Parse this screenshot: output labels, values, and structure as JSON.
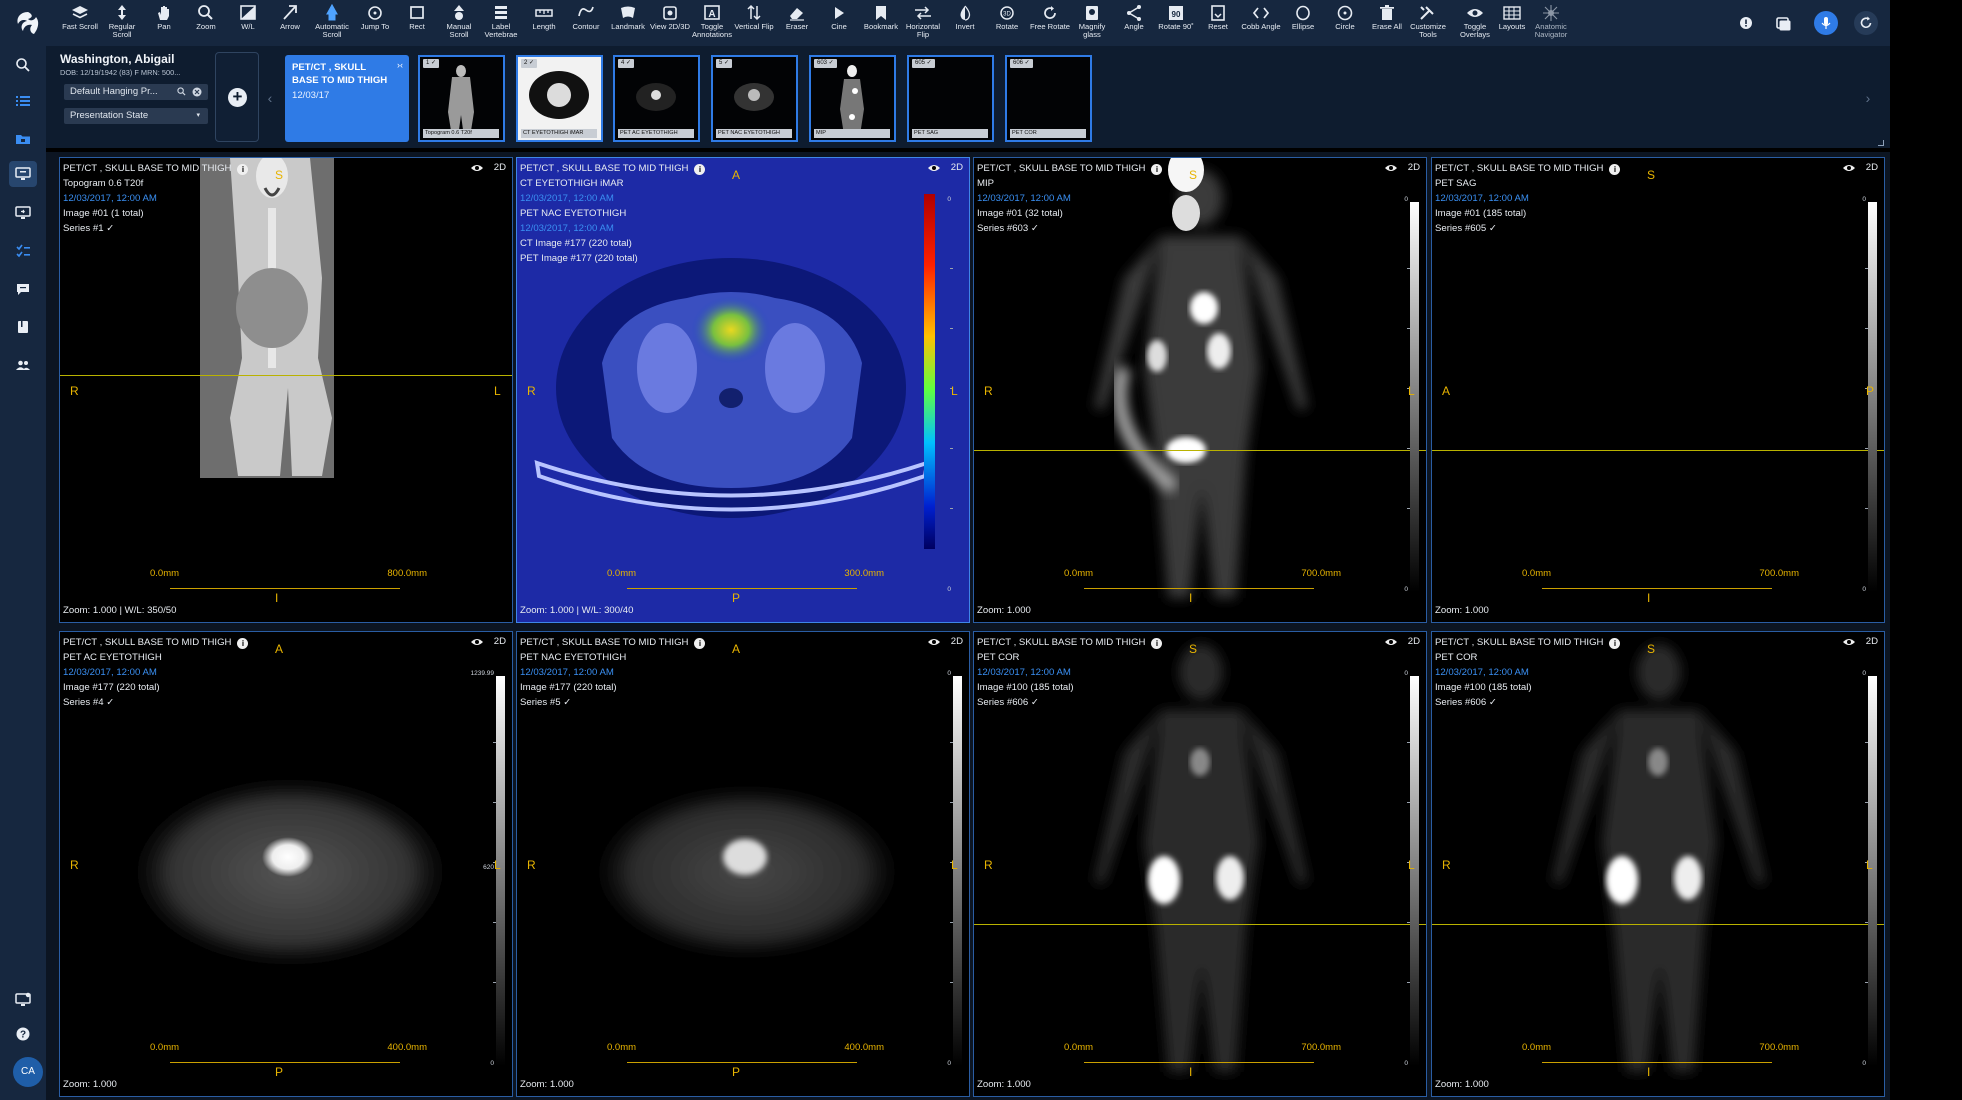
{
  "toolbar": {
    "tools": [
      {
        "label": "Fast Scroll",
        "icon": "layers-icon"
      },
      {
        "label": "Regular Scroll",
        "icon": "scroll-icon"
      },
      {
        "label": "Pan",
        "icon": "hand-icon"
      },
      {
        "label": "Zoom",
        "icon": "magnifier-icon"
      },
      {
        "label": "W/L",
        "icon": "contrast-icon"
      },
      {
        "label": "Arrow",
        "icon": "arrow-icon"
      },
      {
        "label": "Automatic Scroll",
        "icon": "auto-scroll-icon"
      },
      {
        "label": "Jump To",
        "icon": "target-icon"
      },
      {
        "label": "Rect",
        "icon": "rect-icon"
      },
      {
        "label": "Manual Scroll",
        "icon": "manual-scroll-icon"
      },
      {
        "label": "Label Vertebrae",
        "icon": "label-icon"
      },
      {
        "label": "Length",
        "icon": "ruler-icon"
      },
      {
        "label": "Contour",
        "icon": "contour-icon"
      },
      {
        "label": "Landmark",
        "icon": "landmark-icon"
      },
      {
        "label": "View 2D/3D",
        "icon": "view-icon"
      },
      {
        "label": "Toggle Annotations",
        "icon": "annotation-icon"
      },
      {
        "label": "Vertical Flip",
        "icon": "vflip-icon"
      },
      {
        "label": "Eraser",
        "icon": "eraser-icon"
      },
      {
        "label": "Cine",
        "icon": "play-icon"
      },
      {
        "label": "Bookmark",
        "icon": "bookmark-icon"
      },
      {
        "label": "Horizontal Flip",
        "icon": "hflip-icon"
      },
      {
        "label": "Invert",
        "icon": "invert-icon"
      },
      {
        "label": "Rotate",
        "icon": "rotate-icon"
      },
      {
        "label": "Free Rotate",
        "icon": "free-rotate-icon"
      },
      {
        "label": "Magnify glass",
        "icon": "magnify-glass-icon"
      },
      {
        "label": "Angle",
        "icon": "angle-icon"
      },
      {
        "label": "Rotate 90˚",
        "icon": "rotate90-icon"
      },
      {
        "label": "Reset",
        "icon": "reset-icon"
      },
      {
        "label": "Cobb Angle",
        "icon": "cobb-icon"
      },
      {
        "label": "Ellipse",
        "icon": "ellipse-icon"
      },
      {
        "label": "Circle",
        "icon": "circle-icon"
      },
      {
        "label": "Erase All",
        "icon": "trash-icon"
      },
      {
        "label": "Customize Tools",
        "icon": "tools-icon"
      },
      {
        "label": "Toggle Overlays",
        "icon": "eye-icon"
      },
      {
        "label": "Layouts",
        "icon": "grid-icon"
      },
      {
        "label": "Anatomic Navigator",
        "icon": "navigator-icon"
      }
    ],
    "right_icons": [
      "alert-icon",
      "window-icon",
      "microphone-icon",
      "refresh-icon"
    ]
  },
  "sidebar": {
    "items": [
      "search-icon",
      "list-icon",
      "folder-icon",
      "monitor-icon",
      "monitor-out-icon",
      "checklist-icon",
      "chat-icon",
      "book-icon",
      "users-icon"
    ],
    "bottom": [
      "screen-icon",
      "help-icon"
    ],
    "avatar": "CA"
  },
  "patient": {
    "name": "Washington, Abigail",
    "dob_line": "DOB: 12/19/1942 (83)    F    MRN: 500...",
    "hanging": "Default Hanging Pr...",
    "presentation": "Presentation State"
  },
  "study": {
    "title": "PET/CT , SKULL BASE TO MID THIGH",
    "date": "12/03/17"
  },
  "thumbnails": [
    {
      "badge": "1 ✓",
      "caption": "Topogram 0.6 T20f"
    },
    {
      "badge": "2 ✓",
      "caption": "CT EYETOTHIGH iMAR"
    },
    {
      "badge": "4 ✓",
      "caption": "PET AC EYETOTHIGH"
    },
    {
      "badge": "5 ✓",
      "caption": "PET NAC EYETOTHIGH"
    },
    {
      "badge": "603 ✓",
      "caption": "MIP"
    },
    {
      "badge": "605 ✓",
      "caption": "PET SAG"
    },
    {
      "badge": "606 ✓",
      "caption": "PET COR"
    }
  ],
  "viewports": [
    {
      "study": "PET/CT , SKULL BASE TO MID THIGH",
      "series_desc": "Topogram 0.6 T20f",
      "datetime": "12/03/2017, 12:00 AM",
      "line3": "Image #01 (1 total)",
      "line4": "Series #1 ✓",
      "mode": "2D",
      "top": "S",
      "bottom": "I",
      "left": "R",
      "right": "L",
      "scale_start": "0.0mm",
      "scale_end": "800.0mm",
      "zoom": "Zoom: 1.000 | W/L: 350/50"
    },
    {
      "study": "PET/CT , SKULL BASE TO MID THIGH",
      "series_desc": "CT EYETOTHIGH iMAR",
      "series_desc2": "PET NAC EYETOTHIGH",
      "datetime": "12/03/2017, 12:00 AM",
      "datetime2": "12/03/2017, 12:00 AM",
      "line3": "CT Image #177 (220 total)",
      "line4": "PET Image #177 (220 total)",
      "mode": "2D",
      "top": "A",
      "bottom": "P",
      "left": "R",
      "right": "L",
      "scale_start": "0.0mm",
      "scale_end": "300.0mm",
      "zoom": "Zoom: 1.000 | W/L: 300/40",
      "colorbar_top": "0",
      "colorbar_bottom": "0"
    },
    {
      "study": "PET/CT , SKULL BASE TO MID THIGH",
      "series_desc": "MIP",
      "datetime": "12/03/2017, 12:00 AM",
      "line3": "Image #01 (32 total)",
      "line4": "Series #603 ✓",
      "mode": "2D",
      "top": "S",
      "bottom": "I",
      "left": "R",
      "right": "L",
      "scale_start": "0.0mm",
      "scale_end": "700.0mm",
      "zoom": "Zoom: 1.000",
      "colorbar_top": "0",
      "colorbar_bottom": "0"
    },
    {
      "study": "PET/CT , SKULL BASE TO MID THIGH",
      "series_desc": "PET SAG",
      "datetime": "12/03/2017, 12:00 AM",
      "line3": "Image #01 (185 total)",
      "line4": "Series #605 ✓",
      "mode": "2D",
      "top": "S",
      "bottom": "I",
      "left": "A",
      "right": "P",
      "scale_start": "0.0mm",
      "scale_end": "700.0mm",
      "zoom": "Zoom: 1.000",
      "colorbar_top": "0",
      "colorbar_bottom": "0"
    },
    {
      "study": "PET/CT , SKULL BASE TO MID THIGH",
      "series_desc": "PET AC EYETOTHIGH",
      "datetime": "12/03/2017, 12:00 AM",
      "line3": "Image #177 (220 total)",
      "line4": "Series #4 ✓",
      "mode": "2D",
      "top": "A",
      "bottom": "P",
      "left": "R",
      "right": "L",
      "scale_start": "0.0mm",
      "scale_end": "400.0mm",
      "zoom": "Zoom: 1.000",
      "colorbar_top": "1239.99",
      "colorbar_mid": "620",
      "colorbar_bottom": "0"
    },
    {
      "study": "PET/CT , SKULL BASE TO MID THIGH",
      "series_desc": "PET NAC EYETOTHIGH",
      "datetime": "12/03/2017, 12:00 AM",
      "line3": "Image #177 (220 total)",
      "line4": "Series #5 ✓",
      "mode": "2D",
      "top": "A",
      "bottom": "P",
      "left": "R",
      "right": "L",
      "scale_start": "0.0mm",
      "scale_end": "400.0mm",
      "zoom": "Zoom: 1.000",
      "colorbar_top": "0",
      "colorbar_bottom": "0"
    },
    {
      "study": "PET/CT , SKULL BASE TO MID THIGH",
      "series_desc": "PET COR",
      "datetime": "12/03/2017, 12:00 AM",
      "line3": "Image #100 (185 total)",
      "line4": "Series #606 ✓",
      "mode": "2D",
      "top": "S",
      "bottom": "I",
      "left": "R",
      "right": "L",
      "scale_start": "0.0mm",
      "scale_end": "700.0mm",
      "zoom": "Zoom: 1.000",
      "colorbar_top": "0",
      "colorbar_bottom": "0"
    },
    {
      "study": "PET/CT , SKULL BASE TO MID THIGH",
      "series_desc": "PET COR",
      "datetime": "12/03/2017, 12:00 AM",
      "line3": "Image #100 (185 total)",
      "line4": "Series #606 ✓",
      "mode": "2D",
      "top": "S",
      "bottom": "I",
      "left": "R",
      "right": "L",
      "scale_start": "0.0mm",
      "scale_end": "700.0mm",
      "zoom": "Zoom: 1.000",
      "colorbar_top": "0",
      "colorbar_bottom": "0"
    }
  ],
  "colors": {
    "accent": "#2f7be6",
    "orientation": "#e8b400",
    "crosshair": "#b9b200",
    "toolbar": "#16273f"
  }
}
